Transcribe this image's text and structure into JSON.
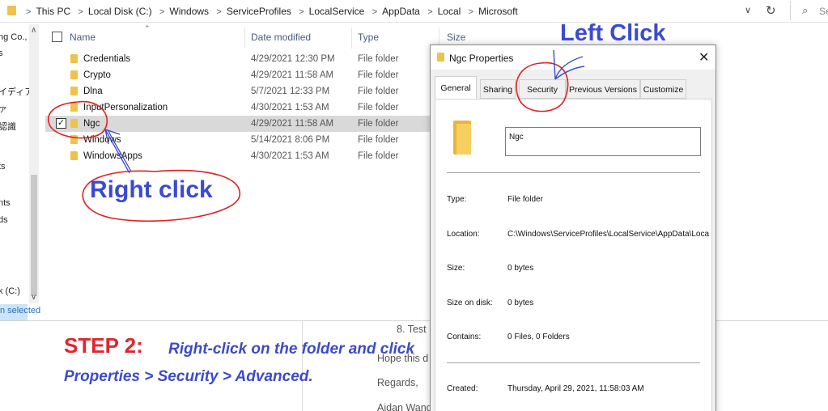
{
  "address_bar": {
    "breadcrumbs": [
      "This PC",
      "Local Disk (C:)",
      "Windows",
      "ServiceProfiles",
      "LocalService",
      "AppData",
      "Local",
      "Microsoft"
    ],
    "separator": ">",
    "search_placeholder": "Se"
  },
  "nav_pane": {
    "items": [
      "ng Co., I",
      "s",
      "イディア",
      "ァ",
      "認識",
      "ts",
      "nts",
      "ds",
      "k (C:)"
    ]
  },
  "status_bar": {
    "text": "n selected"
  },
  "file_list": {
    "columns": {
      "name": "Name",
      "date": "Date modified",
      "type": "Type",
      "size": "Size"
    },
    "rows": [
      {
        "name": "Credentials",
        "date": "4/29/2021 12:30 PM",
        "type": "File folder",
        "selected": false
      },
      {
        "name": "Crypto",
        "date": "4/29/2021 11:58 AM",
        "type": "File folder",
        "selected": false
      },
      {
        "name": "Dlna",
        "date": "5/7/2021 12:33 PM",
        "type": "File folder",
        "selected": false
      },
      {
        "name": "InputPersonalization",
        "date": "4/30/2021 1:53 AM",
        "type": "File folder",
        "selected": false
      },
      {
        "name": "Ngc",
        "date": "4/29/2021 11:58 AM",
        "type": "File folder",
        "selected": true
      },
      {
        "name": "Windows",
        "date": "5/14/2021 8:06 PM",
        "type": "File folder",
        "selected": false
      },
      {
        "name": "WindowsApps",
        "date": "4/30/2021 1:53 AM",
        "type": "File folder",
        "selected": false
      }
    ]
  },
  "dialog": {
    "title": "Ngc Properties",
    "close_glyph": "✕",
    "tabs": [
      "General",
      "Sharing",
      "Security",
      "Previous Versions",
      "Customize"
    ],
    "active_tab": "General",
    "folder_name": "Ngc",
    "properties": {
      "type_label": "Type:",
      "type_value": "File folder",
      "location_label": "Location:",
      "location_value": "C:\\Windows\\ServiceProfiles\\LocalService\\AppData\\Loca",
      "size_label": "Size:",
      "size_value": "0 bytes",
      "size_on_disk_label": "Size on disk:",
      "size_on_disk_value": "0 bytes",
      "contains_label": "Contains:",
      "contains_value": "0 Files, 0 Folders",
      "created_label": "Created:",
      "created_value": "Thursday, April 29, 2021, 11:58:03 AM"
    }
  },
  "document": {
    "step_label": "STEP 2:",
    "instruction_line1": "Right-click on the folder and click",
    "instruction_line2": "Properties > Security > Advanced.",
    "list_item": "8. Test",
    "hope_text": "Hope this d",
    "regards": "Regards,",
    "signature": "Aidan Wang"
  },
  "annotations": {
    "left_click": "Left Click",
    "right_click": "Right click",
    "color": "#3b4bd1",
    "circle_color": "#e02020"
  },
  "colors": {
    "folder": "#f0c24b",
    "step_red": "#e0252e",
    "instruction_blue": "#3c4bc8",
    "selected_row": "#d9d9d9"
  }
}
